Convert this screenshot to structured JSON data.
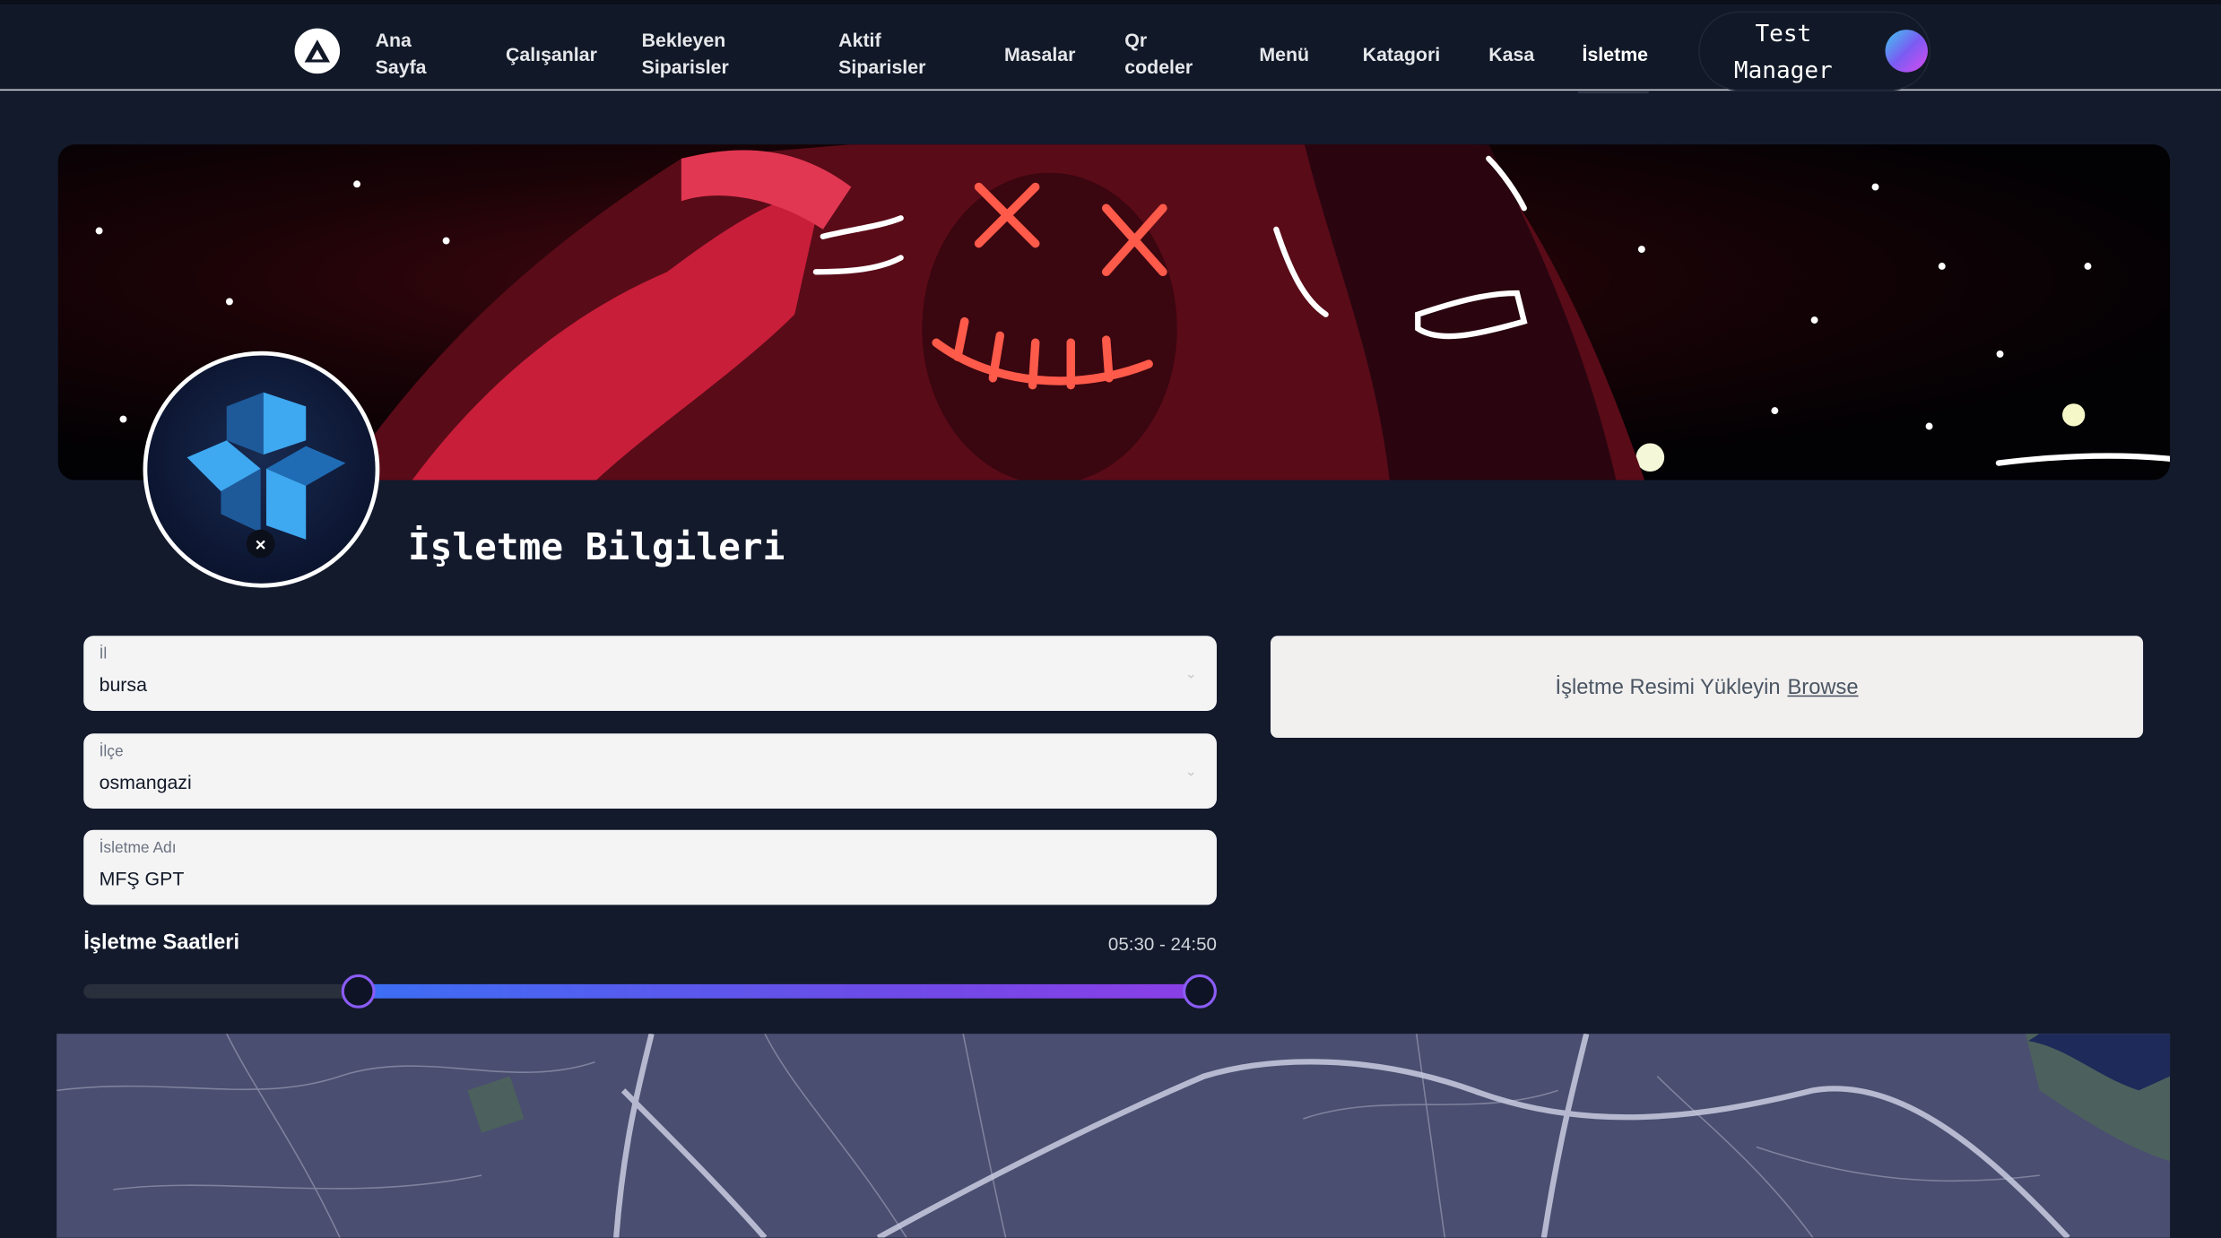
{
  "nav": {
    "items": [
      {
        "label": "Ana\nSayfa"
      },
      {
        "label": "Çalışanlar"
      },
      {
        "label": "Bekleyen\nSiparisler"
      },
      {
        "label": "Aktif\nSiparisler"
      },
      {
        "label": "Masalar"
      },
      {
        "label": "Qr\ncodeler"
      },
      {
        "label": "Menü"
      },
      {
        "label": "Katagori"
      },
      {
        "label": "Kasa"
      },
      {
        "label": "İsletme"
      }
    ],
    "active_index": 9,
    "user_name": "Test\nManager",
    "logo_icon": "triangle-logo-icon",
    "avatar_icon": "gradient-avatar"
  },
  "profile": {
    "logo_icon": "blue-cube-logo-icon",
    "remove_label": "×"
  },
  "page": {
    "title": "İşletme Bilgileri"
  },
  "form": {
    "il": {
      "label": "İl",
      "value": "bursa"
    },
    "ilce": {
      "label": "İlçe",
      "value": "osmangazi"
    },
    "isletme_adi": {
      "label": "İsletme Adı",
      "value": "MFŞ GPT"
    }
  },
  "upload": {
    "text": "İşletme Resimi Yükleyin",
    "browse": "Browse"
  },
  "hours": {
    "label": "İşletme Saatleri",
    "value": "05:30 - 24:50",
    "start_fraction": 0.235,
    "end_fraction": 1.0
  },
  "colors": {
    "background": "#131a2c",
    "topbar": "#111827",
    "slider_start": "#3b6ff5",
    "slider_end": "#8b3ee6",
    "map": "#4a4e70"
  }
}
